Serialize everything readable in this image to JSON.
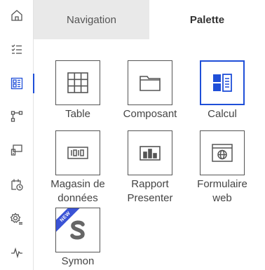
{
  "rail": {
    "items": [
      {
        "icon": "home-icon"
      },
      {
        "icon": "checklist-icon"
      },
      {
        "icon": "palette-grid-icon",
        "active": true
      },
      {
        "icon": "workflow-icon"
      },
      {
        "icon": "screen-icon"
      },
      {
        "icon": "calendar-clock-icon"
      },
      {
        "icon": "settings-list-icon"
      },
      {
        "icon": "pulse-icon"
      }
    ]
  },
  "tabs": {
    "navigation": "Navigation",
    "palette": "Palette"
  },
  "palette": {
    "items": [
      {
        "label": "Table",
        "icon": "table-grid-icon"
      },
      {
        "label": "Composant",
        "icon": "folder-icon"
      },
      {
        "label": "Calcul",
        "icon": "calculator-icon",
        "selected": true
      },
      {
        "label": "Magasin de\ndonnées",
        "icon": "data-store-icon"
      },
      {
        "label": "Rapport\nPresenter",
        "icon": "report-chart-icon"
      },
      {
        "label": "Formulaire\nweb",
        "icon": "web-form-icon"
      },
      {
        "label": "Symon",
        "icon": "symon-logo-icon",
        "badge": "NEW"
      }
    ]
  },
  "colors": {
    "accent": "#1f4fd8",
    "tab_inactive_bg": "#e9e9e9",
    "ribbon": "#3a53d6"
  }
}
